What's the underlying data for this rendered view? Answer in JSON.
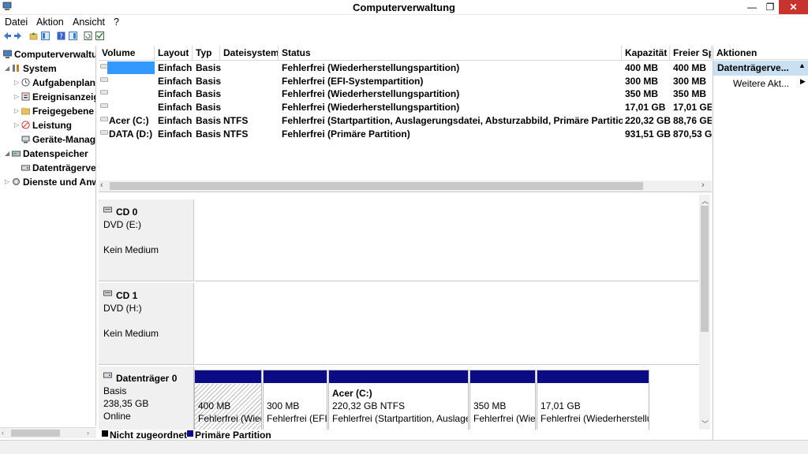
{
  "window": {
    "title": "Computerverwaltung",
    "min": "—",
    "max": "❐",
    "close": "✕"
  },
  "menu": [
    "Datei",
    "Aktion",
    "Ansicht",
    "?"
  ],
  "tree": {
    "root": "Computerverwaltu",
    "system": "System",
    "items": [
      "Aufgabenplan",
      "Ereignisanzeig",
      "Freigegebene (",
      "Leistung",
      "Geräte-Manag"
    ],
    "storage": "Datenspeicher",
    "storage_child": "Datenträgerve",
    "services": "Dienste und Anw"
  },
  "volumes": {
    "headers": [
      "Volume",
      "Layout",
      "Typ",
      "Dateisystem",
      "Status",
      "Kapazität",
      "Freier Sp"
    ],
    "rows": [
      [
        "",
        "Einfach",
        "Basis",
        "",
        "Fehlerfrei (Wiederherstellungspartition)",
        "400 MB",
        "400 MB"
      ],
      [
        "",
        "Einfach",
        "Basis",
        "",
        "Fehlerfrei (EFI-Systempartition)",
        "300 MB",
        "300 MB"
      ],
      [
        "",
        "Einfach",
        "Basis",
        "",
        "Fehlerfrei (Wiederherstellungspartition)",
        "350 MB",
        "350 MB"
      ],
      [
        "",
        "Einfach",
        "Basis",
        "",
        "Fehlerfrei (Wiederherstellungspartition)",
        "17,01 GB",
        "17,01 GE"
      ],
      [
        "Acer (C:)",
        "Einfach",
        "Basis",
        "NTFS",
        "Fehlerfrei (Startpartition, Auslagerungsdatei, Absturzabbild, Primäre Partition)",
        "220,32 GB",
        "88,76 GE"
      ],
      [
        "DATA (D:)",
        "Einfach",
        "Basis",
        "NTFS",
        "Fehlerfrei (Primäre Partition)",
        "931,51 GB",
        "870,53 G"
      ]
    ]
  },
  "disks": [
    {
      "name": "CD 0",
      "type": "DVD (E:)",
      "media": "Kein Medium"
    },
    {
      "name": "CD 1",
      "type": "DVD (H:)",
      "media": "Kein Medium"
    },
    {
      "name": "Datenträger 0",
      "kind": "Basis",
      "size": "238,35 GB",
      "state": "Online",
      "partitions": [
        {
          "title": "",
          "size": "400 MB",
          "status": "Fehlerfrei (Wiec"
        },
        {
          "title": "",
          "size": "300 MB",
          "status": "Fehlerfrei (EFI-"
        },
        {
          "title": "Acer  (C:)",
          "size": "220,32 GB NTFS",
          "status": "Fehlerfrei (Startpartition, Auslager"
        },
        {
          "title": "",
          "size": "350 MB",
          "status": "Fehlerfrei (Wiec"
        },
        {
          "title": "",
          "size": "17,01 GB",
          "status": "Fehlerfrei (Wiederherstellu"
        }
      ]
    }
  ],
  "legend": {
    "unallocated": "Nicht zugeordnet",
    "primary": "Primäre Partition"
  },
  "actions": {
    "header": "Aktionen",
    "section": "Datenträgerve...",
    "more": "Weitere Akt..."
  },
  "colors": {
    "partition_bar": "#0b0b85",
    "selection": "#c9e0f3",
    "close": "#c7342e"
  }
}
